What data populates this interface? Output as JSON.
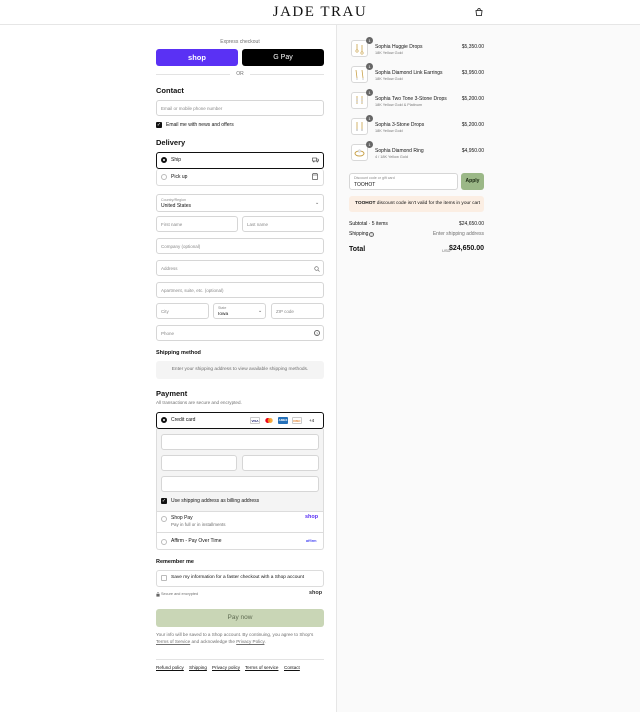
{
  "header": {
    "brand": "JADE TRAU"
  },
  "express": {
    "label": "Express checkout",
    "shop_label": "shop",
    "gpay_label": "G Pay",
    "or_label": "OR"
  },
  "contact": {
    "heading": "Contact",
    "email_placeholder": "Email or mobile phone number",
    "news_label": "Email me with news and offers",
    "news_checked": true
  },
  "delivery": {
    "heading": "Delivery",
    "options": [
      {
        "label": "Ship",
        "selected": true
      },
      {
        "label": "Pick up",
        "selected": false
      }
    ],
    "country_label": "Country/Region",
    "country_value": "United States",
    "first_name": "First name",
    "last_name": "Last name",
    "company": "Company (optional)",
    "address": "Address",
    "apartment": "Apartment, suite, etc. (optional)",
    "city": "City",
    "state_label": "State",
    "state_value": "Iowa",
    "zip": "ZIP code",
    "phone": "Phone"
  },
  "shipping_method": {
    "heading": "Shipping method",
    "message": "Enter your shipping address to view available shipping methods."
  },
  "payment": {
    "heading": "Payment",
    "subtitle": "All transactions are secure and encrypted.",
    "credit_card_label": "Credit card",
    "card_brands": [
      "VISA",
      "MC",
      "AMEX",
      "DISC"
    ],
    "more_cards": "+4",
    "billing_label": "Use shipping address as billing address",
    "shop_pay_label": "Shop Pay",
    "shop_pay_sub": "Pay in full or in installments",
    "shop_pay_logo": "shop",
    "affirm_label": "Affirm - Pay Over Time",
    "affirm_logo": "affirm"
  },
  "remember": {
    "heading": "Remember me",
    "save_label": "Save my information for a faster checkout with a Shop account",
    "secure_label": "Secure and encrypted",
    "shop_logo": "shop"
  },
  "pay_now": "Pay now",
  "legal": {
    "line1": "Your info will be saved to a Shop account. By continuing, you agree to Shop's",
    "terms": "Terms of Service",
    "and": "and acknowledge the",
    "privacy": "Privacy Policy",
    "end": "."
  },
  "footer_links": [
    "Refund policy",
    "Shipping",
    "Privacy policy",
    "Terms of service",
    "Contact"
  ],
  "cart": {
    "items": [
      {
        "qty": "1",
        "name": "Sophia Huggie Drops",
        "variant": "18K Yellow Gold",
        "price": "$5,350.00"
      },
      {
        "qty": "1",
        "name": "Sophia Diamond Link Earrings",
        "variant": "18K Yellow Gold",
        "price": "$3,950.00"
      },
      {
        "qty": "1",
        "name": "Sophia Two Tone 3-Stone Drops",
        "variant": "18K Yellow Gold & Platinum",
        "price": "$5,200.00"
      },
      {
        "qty": "1",
        "name": "Sophia 3-Stone Drops",
        "variant": "18K Yellow Gold",
        "price": "$5,200.00"
      },
      {
        "qty": "1",
        "name": "Sophia Diamond Ring",
        "variant": "4 / 18K Yellow Gold",
        "price": "$4,950.00"
      }
    ],
    "discount_label": "Discount code or gift card",
    "discount_value": "TOOHOT",
    "apply_label": "Apply",
    "error_code": "TOOHOT",
    "error_text": "discount code isn't valid for the items in your cart",
    "subtotal_label": "Subtotal · 5 items",
    "subtotal_value": "$24,650.00",
    "shipping_label": "Shipping",
    "shipping_value": "Enter shipping address",
    "total_label": "Total",
    "currency": "USD",
    "total_value": "$24,650.00"
  },
  "colors": {
    "shop_purple": "#5a31f4",
    "pay_green": "#c9d6b6",
    "error_bg": "#fbeee3",
    "apply_green": "#9bb887"
  }
}
